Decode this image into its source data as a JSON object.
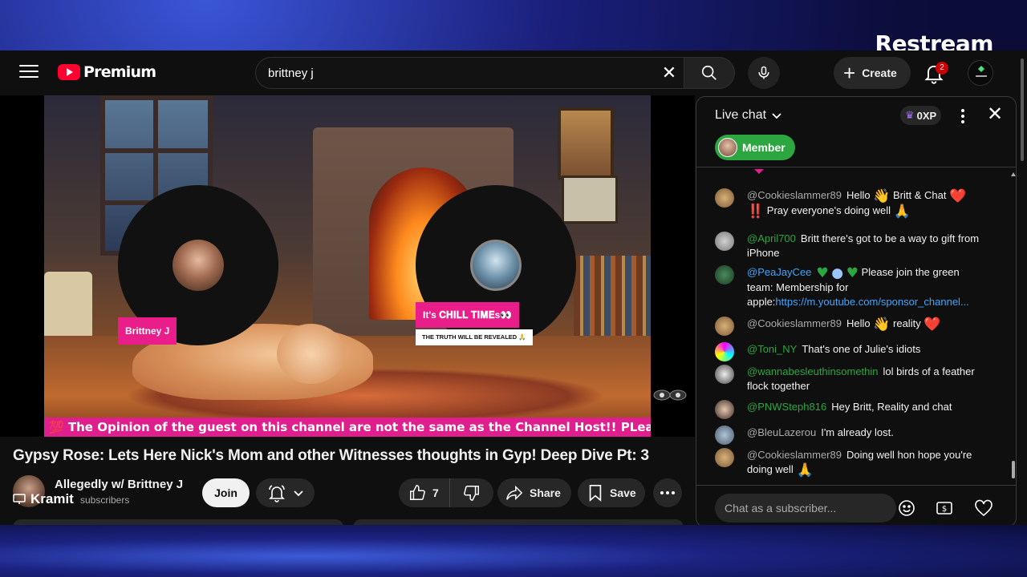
{
  "overlay": {
    "brand": "Restream"
  },
  "header": {
    "logo_text": "Premium",
    "search": {
      "value": "brittney j",
      "placeholder": "Search"
    },
    "create_label": "Create",
    "notifications_count": "2"
  },
  "video": {
    "guest_name": "Brittney J",
    "status_text": "It's 𝐂𝐇𝐈𝐋𝐋 𝐓𝐈𝐌𝐄s👀",
    "truth_text": "THE TRUTH WILL BE REVEALED 🙏",
    "ticker": "💯 The Opinion of the guest on this channel are not the same as the Channel Host!! PLease be Kin"
  },
  "meta": {
    "title": "Gypsy Rose: Lets Here Nick's Mom and other Witnesses thoughts in Gyp! Deep Dive Pt: 3",
    "channel_name": "Allegedly w/ Brittney J",
    "subscribers": "subscribers",
    "stream_label": "Kramit",
    "join_label": "Join",
    "likes": "7",
    "share_label": "Share",
    "save_label": "Save"
  },
  "chat": {
    "title": "Live chat",
    "xp": "0XP",
    "member_label": "Member",
    "input_placeholder": "Chat as a subscriber...",
    "messages": [
      {
        "author": "@Cookieslammer89",
        "text1": "Hello",
        "e1": "👋",
        "text2": "Britt & Chat",
        "e2": "❤️",
        "e3": "‼️",
        "text3": "Pray everyone's doing well",
        "e4": "🙏"
      },
      {
        "author": "@April700",
        "text": "Britt there's got to be a way to gift from iPhone"
      },
      {
        "author": "@PeaJayCee",
        "text1": "Please join the green team: Membership for apple:",
        "link": "https://m.youtube.com/sponsor_channel..."
      },
      {
        "author": "@Cookieslammer89",
        "text1": "Hello",
        "text2": "reality"
      },
      {
        "author": "@Toni_NY",
        "text": "That's one of Julie's idiots"
      },
      {
        "author": "@wannabesleuthinsomethin",
        "text": "lol birds of a feather flock together"
      },
      {
        "author": "@PNWSteph816",
        "text": "Hey Britt, Reality and chat"
      },
      {
        "author": "@BleuLazerou",
        "text": "I'm already lost."
      },
      {
        "author": "@Cookieslammer89",
        "text": "Doing well hon hope you're doing well"
      }
    ]
  }
}
